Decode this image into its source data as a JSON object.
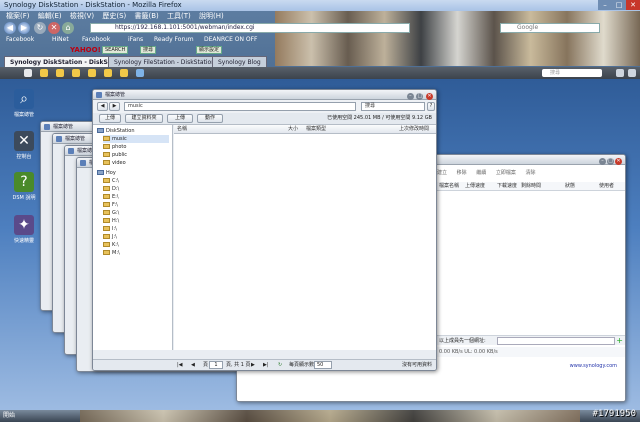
{
  "browser": {
    "title": "Synology DiskStation - DiskStation - Mozilla Firefox",
    "url": "https://192.168.1.101:5001/webman/index.cgi",
    "search_placeholder": "Google",
    "menu": [
      "檔案(F)",
      "編輯(E)",
      "檢視(V)",
      "歷史(S)",
      "書籤(B)",
      "工具(T)",
      "說明(H)"
    ],
    "bookmarks": [
      "Facebook",
      "HiNet",
      "Facebook",
      "iFans",
      "Ready Forum",
      "DEANRCE ON OFF"
    ],
    "toolbar2": {
      "yahoo": "YAHOO!",
      "search": "SEARCH",
      "btn1": "搜尋",
      "btn2": "顯示設定"
    },
    "tabs": [
      {
        "label": "Synology DiskStation - DiskStation"
      },
      {
        "label": "Synology FileStation - DiskStation"
      },
      {
        "label": "Synology Blog"
      }
    ]
  },
  "dsm": {
    "search_placeholder": "搜尋",
    "desktop_icons": [
      {
        "label": "檔案總管"
      },
      {
        "label": "控制台"
      },
      {
        "label": "DSM 說明"
      },
      {
        "label": "快速精靈"
      }
    ]
  },
  "window": {
    "title": "檔案總管",
    "path": "music",
    "search_placeholder": "搜尋",
    "buttons": {
      "upload": "上傳",
      "create_folder": "建立資料夾",
      "upload2": "上傳",
      "action": "動作"
    },
    "free_space": "已使用空間 245.01 MB / 可使用空間 9.12 GB",
    "tree": {
      "root": "DiskStation",
      "folders": [
        "music",
        "photo",
        "public",
        "video"
      ],
      "pc": "Hoy",
      "drives": [
        "C:\\",
        "D:\\",
        "E:\\",
        "F:\\",
        "G:\\",
        "H:\\",
        "I:\\",
        "J:\\",
        "K:\\",
        "M:\\"
      ]
    },
    "columns": [
      "名稱",
      "大小",
      "檔案類型",
      "上次修改時間"
    ],
    "pager": {
      "page_label": "頁",
      "page": "1",
      "of": "頁, 共 1 頁",
      "per_page_label": "每頁顯示數",
      "per_page": "50",
      "status": "沒有可用資料"
    }
  },
  "right_window": {
    "toolbar": [
      "建立",
      "移除",
      "繼續",
      "立即檔案",
      "清除"
    ],
    "columns": [
      "檔案名稱",
      "上傳速度",
      "下載速度",
      "剩餘時間",
      "狀態",
      "使用者"
    ],
    "bottom_label": "以上成員先一個網址:",
    "bottom2": "0.00 KB/s   UL: 0.00 KB/s",
    "link": "www.synology.com",
    "status": "沒有可用資料"
  },
  "taskbar": {
    "start": "開始",
    "watermark": "#1791950"
  }
}
